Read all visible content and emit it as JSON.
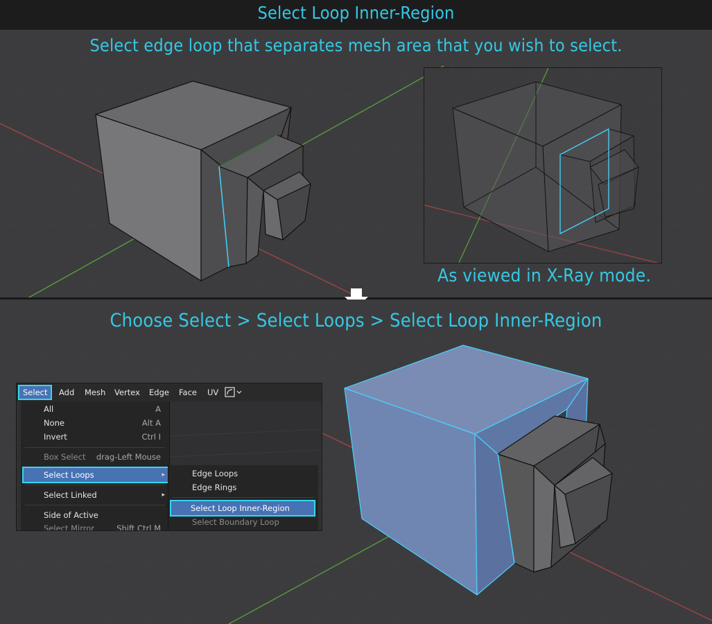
{
  "header": {
    "title": "Select Loop Inner-Region",
    "subtitle": "Select edge loop that separates mesh area that you wish to select.",
    "xray_caption": "As viewed in X-Ray mode.",
    "step_caption": "Choose Select > Select Loops > Select Loop Inner-Region"
  },
  "menubar": {
    "items": [
      "Select",
      "Add",
      "Mesh",
      "Vertex",
      "Edge",
      "Face",
      "UV"
    ],
    "active": "Select",
    "dropdown_icon": "vertex-select-mode-icon"
  },
  "select_menu": {
    "items": [
      {
        "label": "All",
        "shortcut": "A"
      },
      {
        "label": "None",
        "shortcut": "Alt A"
      },
      {
        "label": "Invert",
        "shortcut": "Ctrl I"
      },
      {
        "label": "Box Select",
        "shortcut": "drag-Left Mouse"
      },
      {
        "label": "Select Loops",
        "shortcut": "▸"
      },
      {
        "label": "Select Linked",
        "shortcut": "▸"
      },
      {
        "label": "Side of Active",
        "shortcut": ""
      },
      {
        "label": "Select Mirror",
        "shortcut": "Shift Ctrl M"
      }
    ],
    "active": "Select Loops"
  },
  "loops_submenu": {
    "items": [
      "Edge Loops",
      "Edge Rings",
      "Select Loop Inner-Region",
      "Select Boundary Loop"
    ],
    "active": "Select Loop Inner-Region"
  },
  "colors": {
    "caption": "#35c8e4",
    "highlight": "#4772b3",
    "outline": "#35d8f0",
    "selected_face": "#6f86b2",
    "x_axis": "#b04848",
    "y_axis": "#5aa23c"
  }
}
